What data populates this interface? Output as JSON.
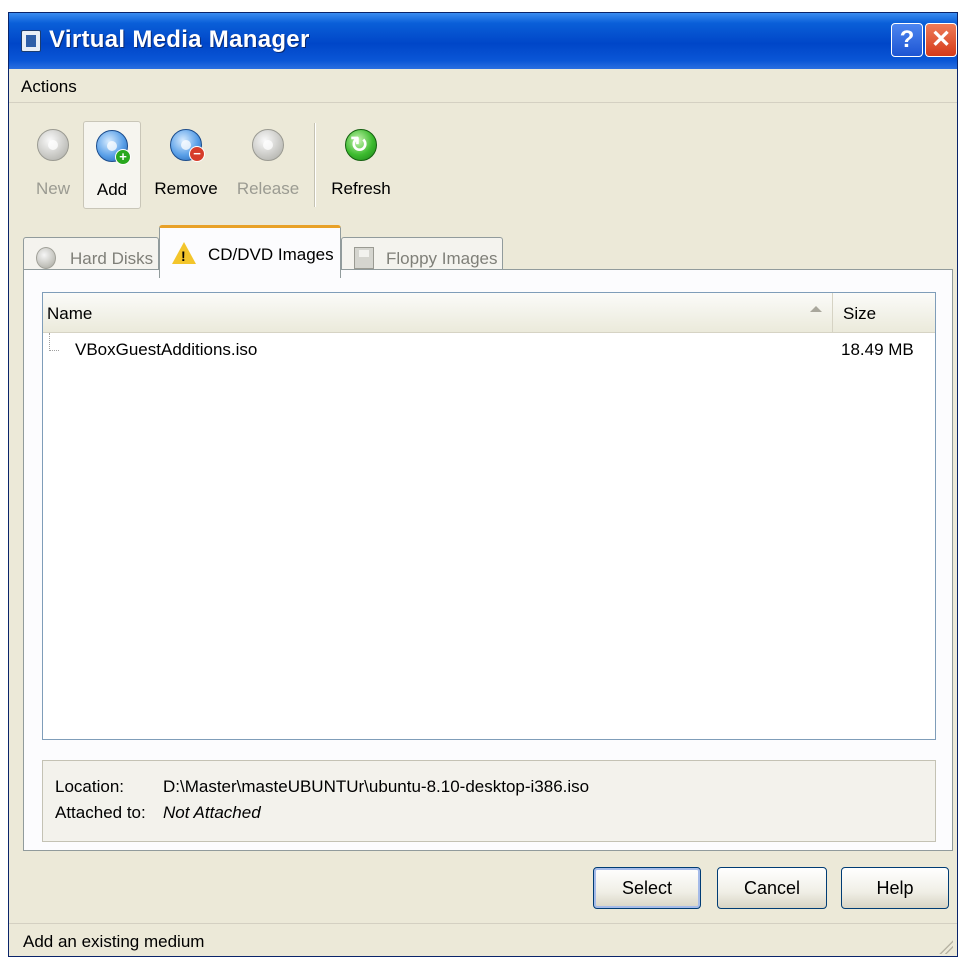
{
  "window": {
    "title": "Virtual Media Manager",
    "help_glyph": "?",
    "close_glyph": "✕"
  },
  "menubar": {
    "actions_label": "Actions"
  },
  "toolbar": {
    "new_label": "New",
    "add_label": "Add",
    "remove_label": "Remove",
    "release_label": "Release",
    "refresh_label": "Refresh"
  },
  "tabs": [
    {
      "label": "Hard Disks",
      "icon": "hard-disk-icon",
      "active": false
    },
    {
      "label": "CD/DVD Images",
      "icon": "warning-icon",
      "active": true
    },
    {
      "label": "Floppy Images",
      "icon": "floppy-icon",
      "active": false
    }
  ],
  "list": {
    "columns": {
      "name": "Name",
      "size": "Size"
    },
    "rows": [
      {
        "name": "VBoxGuestAdditions.iso",
        "size": "18.49 MB"
      }
    ]
  },
  "info": {
    "location_label": "Location:",
    "location_value": "D:\\Master\\masteUBUNTUr\\ubuntu-8.10-desktop-i386.iso",
    "attached_label": "Attached to:",
    "attached_value": "Not Attached"
  },
  "buttons": {
    "select_label": "Select",
    "cancel_label": "Cancel",
    "help_label": "Help"
  },
  "statusbar": {
    "text": "Add an existing medium"
  },
  "colors": {
    "titlebar": "#0a5fd8",
    "active_tab_accent": "#e8a128",
    "window_bg": "#ece9d8"
  }
}
